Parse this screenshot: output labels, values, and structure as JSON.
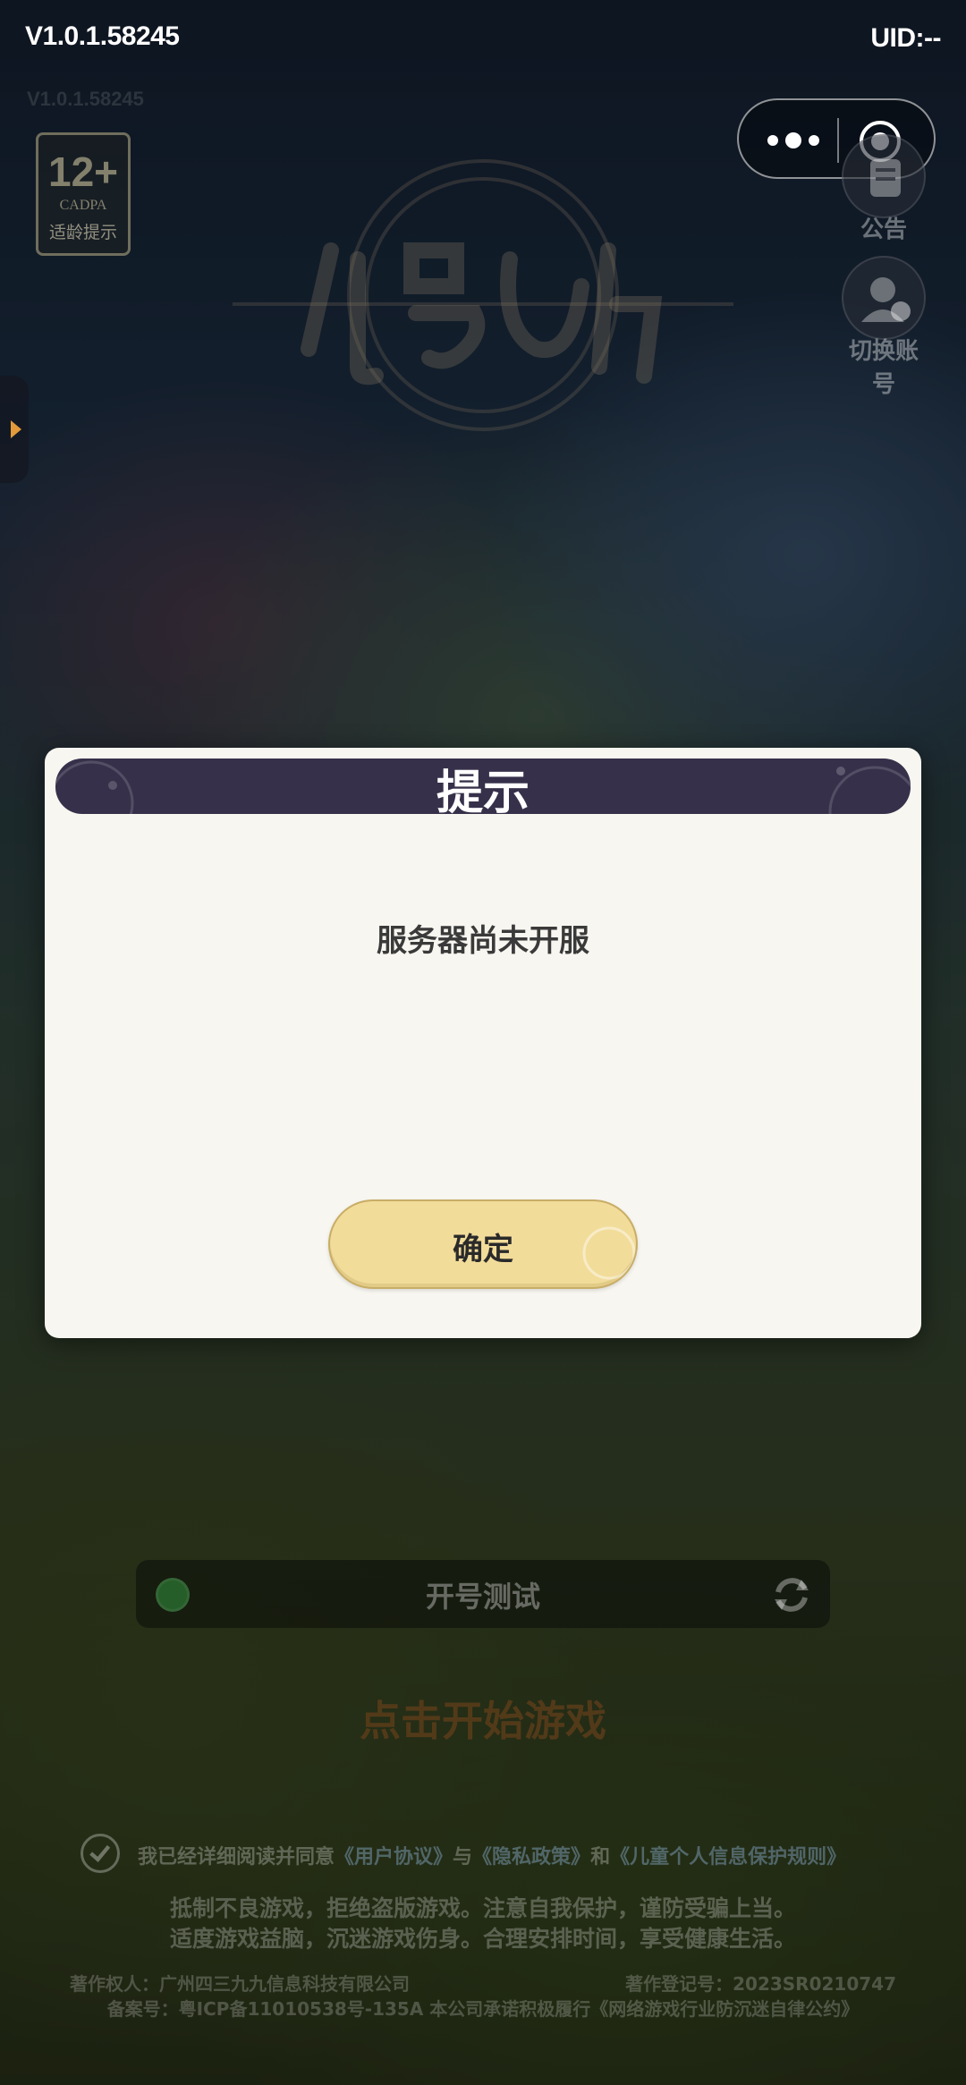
{
  "header": {
    "version": "V1.0.1.58245",
    "version_faint": "V1.0.1.58245",
    "uid": "UID:--"
  },
  "capsule": {
    "more_icon": "more-dots-icon",
    "close_icon": "target-close-icon"
  },
  "age_rating": {
    "number": "12+",
    "org": "CADPA",
    "label": "适龄提示"
  },
  "side_buttons": {
    "notice": {
      "label": "公告",
      "icon": "notice-icon"
    },
    "switch_account": {
      "label": "切换账号",
      "icon": "user-switch-icon"
    }
  },
  "server": {
    "name": "开号测试",
    "status_color": "#2f8a3a",
    "icon": "refresh-icon"
  },
  "start_game": "点击开始游戏",
  "agreement": {
    "prefix": "我已经详细阅读并同意",
    "user_agreement": "《用户协议》",
    "and1": "与",
    "privacy_policy": "《隐私政策》",
    "and2": "和",
    "child_policy": "《儿童个人信息保护规则》"
  },
  "health_notice": {
    "line1": "抵制不良游戏，拒绝盗版游戏。注意自我保护，谨防受骗上当。",
    "line2": "适度游戏益脑，沉迷游戏伤身。合理安排时间，享受健康生活。"
  },
  "legal": {
    "copyright_owner": "著作权人：广州四三九九信息科技有限公司",
    "copyright_reg": "著作登记号：2023SR0210747",
    "icp": "备案号：粤ICP备11010538号-135A    本公司承诺积极履行《网络游戏行业防沉迷自律公约》"
  },
  "dialog": {
    "title": "提示",
    "message": "服务器尚未开服",
    "confirm_label": "确定"
  },
  "colors": {
    "dialog_bg": "#f8f6f0",
    "dialog_header": "#36304a",
    "confirm_button": "#f2dc9a"
  }
}
